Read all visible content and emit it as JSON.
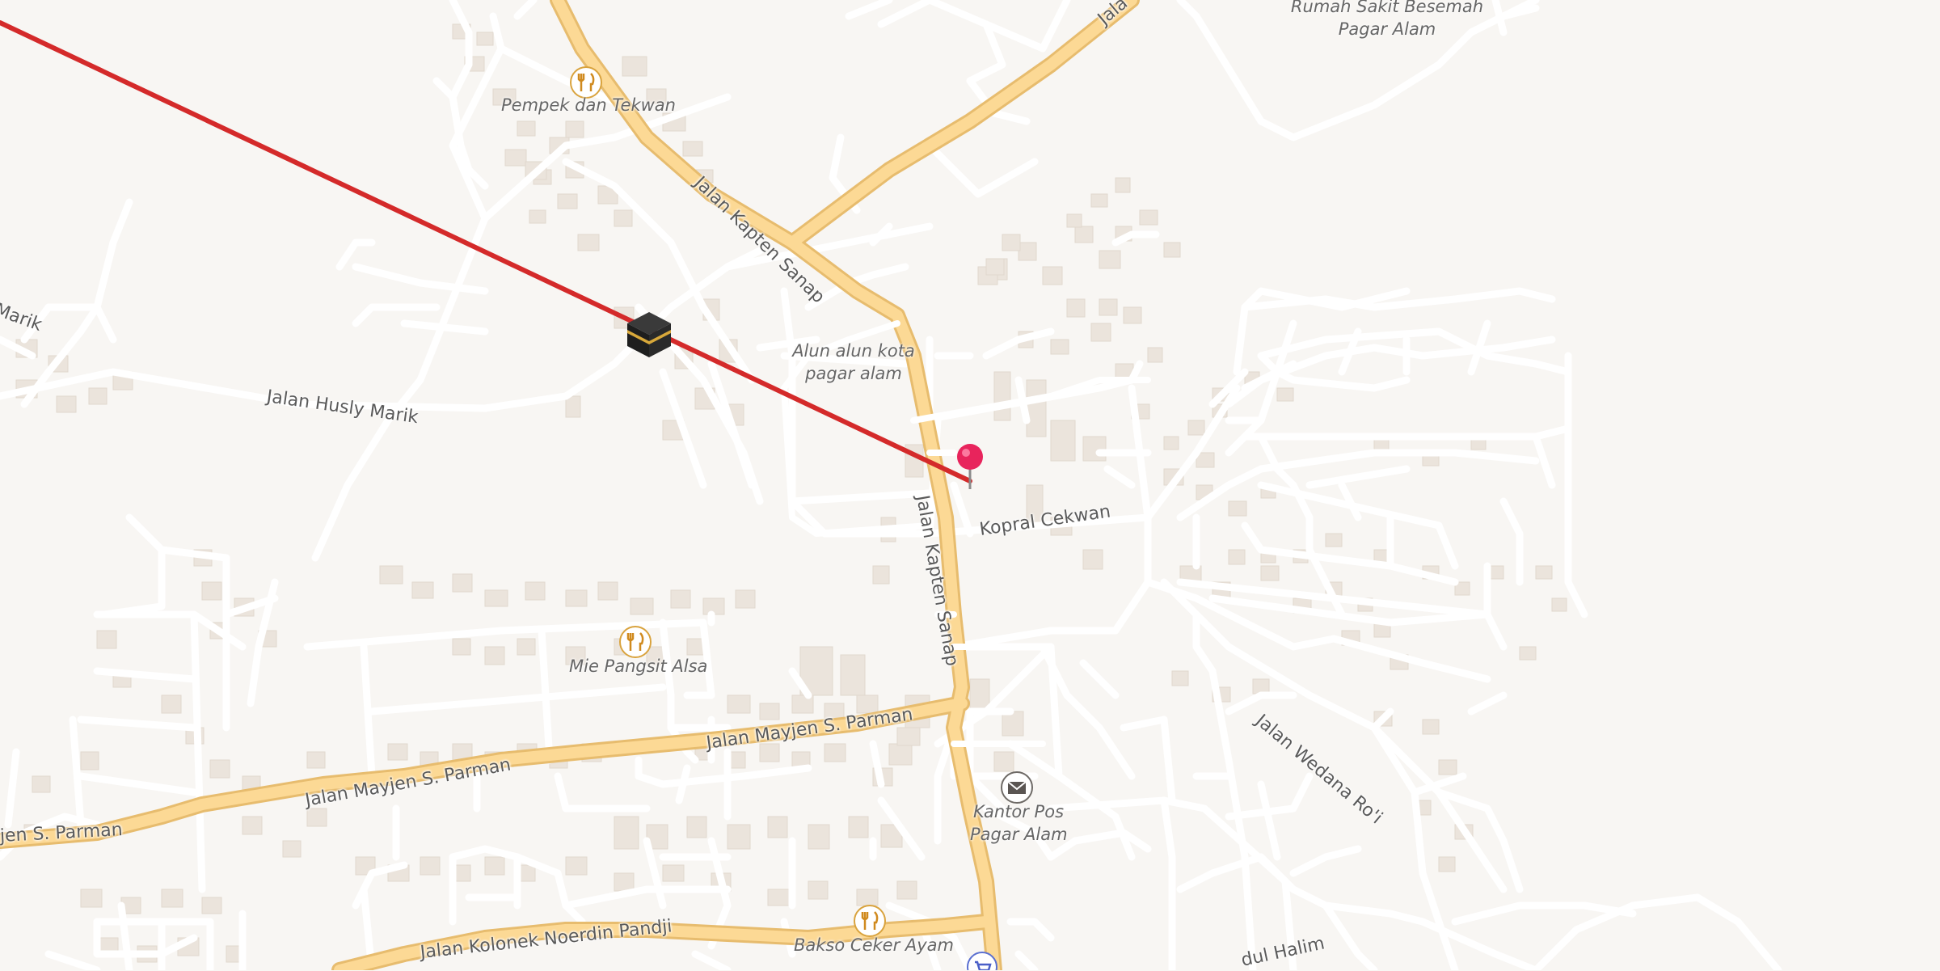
{
  "map": {
    "road_labels": {
      "kapten_sanap_north": "Jalan Kapten Sanap",
      "kapten_sanap_south": "Jalan Kapten Sanap",
      "husly_marik": "Jalan Husly Marik",
      "husly_marik_west": "Marik",
      "kopral_cekwan": "Kopral Cekwan",
      "mayjen_parman_east": "Jalan Mayjen S. Parman",
      "mayjen_parman_mid": "Jalan Mayjen S. Parman",
      "mayjen_parman_west": "jen S. Parman",
      "wedana_roi": "Jalan Wedana Ro'i",
      "kolonek_noerdin": "Jalan Kolonek Noerdin Pandji",
      "jalan_ne": "Jala",
      "halim": "dul Halim"
    },
    "pois": [
      {
        "name": "Pempek dan Tekwan",
        "icon": "restaurant-icon"
      },
      {
        "name": "Mie Pangsit Alsa",
        "icon": "restaurant-icon"
      },
      {
        "name": "Bakso Ceker Ayam",
        "icon": "restaurant-icon"
      },
      {
        "name_line1": "Kantor Pos",
        "name_line2": "Pagar Alam",
        "icon": "mail-icon"
      }
    ],
    "area_labels": {
      "alun_line1": "Alun alun kota",
      "alun_line2": "pagar alam",
      "rs_line1": "Rumah Sakit Besemah",
      "rs_line2": "Pagar Alam"
    },
    "qibla_icon": "kaaba-icon",
    "location_icon": "location-pin-icon",
    "colors": {
      "background": "#f8f6f3",
      "major_road": "#fbd98f",
      "major_road_casing": "#e8b765",
      "minor_road": "#ffffff",
      "building": "#ebe5de",
      "qibla_line": "#d42a2a",
      "pin": "#e8245c"
    }
  }
}
